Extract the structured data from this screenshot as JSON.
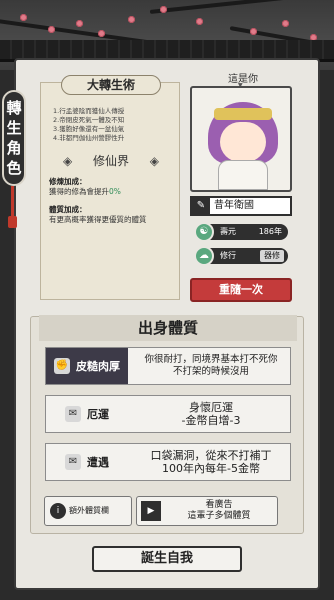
{
  "side_tab": {
    "chars": [
      "轉",
      "生",
      "角",
      "色"
    ]
  },
  "scroll": {
    "title": "大轉生術",
    "lines": [
      "1.行孟婆陰而獲仙人傳授",
      "2.帝閉皮死氣一體及不知",
      "3.獲胞好像還有一盆仙氣",
      "4.非都門伽仙州營膠性升"
    ],
    "realm": "修仙界",
    "cultivation_bonus_title": "修煉加成：",
    "cultivation_bonus_text": "獲得的修為會提升",
    "cultivation_bonus_pct": "0%",
    "physique_bonus_title": "體質加成：",
    "physique_bonus_text": "有更高概率獲得更優質的體質"
  },
  "character": {
    "label": "這是你",
    "name": "昔年衛國",
    "lifespan_label": "壽元",
    "lifespan_value": "186年",
    "cultivation_label": "修行",
    "cultivation_value": "器修"
  },
  "reroll_label": "重隨一次",
  "origin": {
    "title": "出身體質",
    "traits": [
      {
        "tag": "皮糙肉厚",
        "icon": "fist-icon",
        "desc": "你很耐打，同境界基本打不死你\n不打架的時候沒用",
        "active": true
      },
      {
        "tag": "厄運",
        "icon": "scroll-icon",
        "desc": "身懷厄運\n-金幣自增-3",
        "active": false
      },
      {
        "tag": "遭遇",
        "icon": "scroll-icon",
        "desc": "口袋漏洞，從來不打補丁\n100年內每年-5金幣",
        "active": false
      }
    ],
    "extra_slot_label": "額外體質欄",
    "ad_label_line1": "看廣告",
    "ad_label_line2": "這輩子多個體質"
  },
  "born_button": "誕生自我",
  "colors": {
    "accent_red": "#c43b3b",
    "dark": "#2f2f2f",
    "stat_green": "#5aa87f"
  }
}
